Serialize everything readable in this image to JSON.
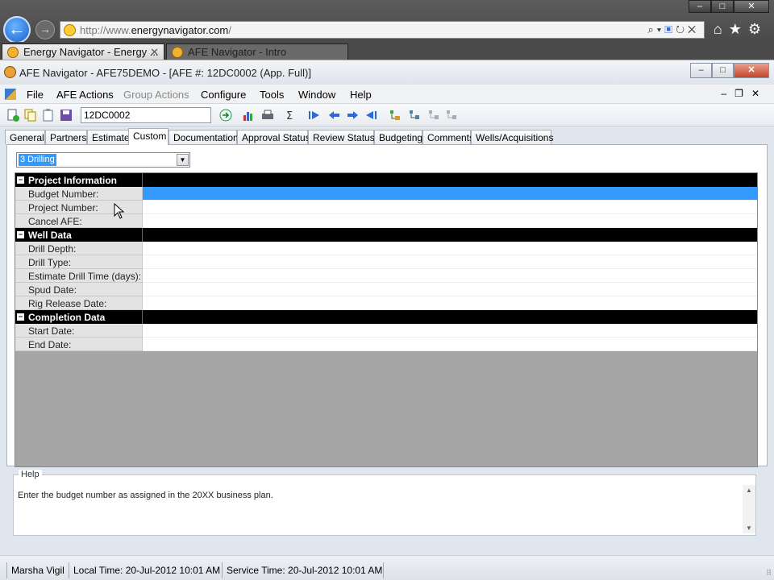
{
  "browser": {
    "url_prefix": "http://www.",
    "url_domain": "energynavigator.com",
    "url_suffix": "/",
    "tabs": [
      {
        "label": "Energy Navigator - Energy ..."
      },
      {
        "label": "AFE Navigator - Intro"
      }
    ]
  },
  "app": {
    "title": "AFE Navigator - AFE75DEMO - [AFE #: 12DC0002   (App. Full)]"
  },
  "menu": {
    "items": [
      {
        "label": "File",
        "enabled": true
      },
      {
        "label": "AFE Actions",
        "enabled": true
      },
      {
        "label": "Group Actions",
        "enabled": false
      },
      {
        "label": "Configure",
        "enabled": true
      },
      {
        "label": "Tools",
        "enabled": true
      },
      {
        "label": "Window",
        "enabled": true
      },
      {
        "label": "Help",
        "enabled": true
      }
    ]
  },
  "toolbar": {
    "afe_number": "12DC0002"
  },
  "form_tabs": [
    {
      "label": "General"
    },
    {
      "label": "Partners"
    },
    {
      "label": "Estimate"
    },
    {
      "label": "Custom",
      "active": true
    },
    {
      "label": "Documentation"
    },
    {
      "label": "Approval Status"
    },
    {
      "label": "Review Status"
    },
    {
      "label": "Budgeting"
    },
    {
      "label": "Comments"
    },
    {
      "label": "Wells/Acquisitions"
    }
  ],
  "custom": {
    "category": "3 Drilling",
    "sections": [
      {
        "title": "Project Information",
        "properties": [
          {
            "name": "Budget Number:",
            "value": "",
            "selected": true
          },
          {
            "name": "Project Number:",
            "value": ""
          },
          {
            "name": "Cancel AFE:",
            "value": ""
          }
        ]
      },
      {
        "title": "Well Data",
        "properties": [
          {
            "name": "Drill Depth:",
            "value": ""
          },
          {
            "name": "Drill Type:",
            "value": ""
          },
          {
            "name": "Estimate Drill Time (days):",
            "value": ""
          },
          {
            "name": "Spud Date:",
            "value": ""
          },
          {
            "name": "Rig Release Date:",
            "value": ""
          }
        ]
      },
      {
        "title": "Completion Data",
        "properties": [
          {
            "name": "Start Date:",
            "value": ""
          },
          {
            "name": "End Date:",
            "value": ""
          }
        ]
      }
    ]
  },
  "help": {
    "label": "Help",
    "text": "Enter the budget number as assigned in the 20XX business plan."
  },
  "status": {
    "user": "Marsha Vigil",
    "local_time": "Local Time: 20-Jul-2012 10:01 AM",
    "service_time": "Service Time: 20-Jul-2012 10:01 AM"
  },
  "colors": {
    "selection": "#3399ff",
    "section_header": "#000000",
    "grid_empty": "#a6a6a6"
  }
}
